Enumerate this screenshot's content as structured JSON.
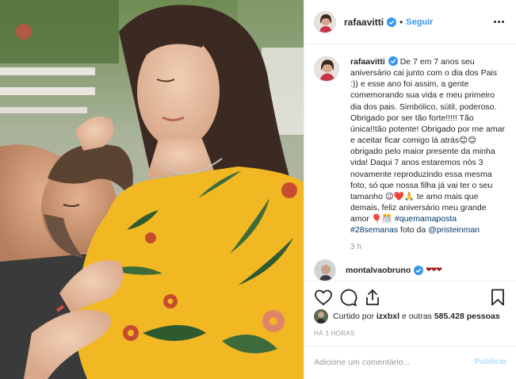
{
  "header": {
    "username": "rafaavitti",
    "separator": "•",
    "follow_label": "Seguir"
  },
  "caption": {
    "username": "rafaavitti",
    "text_parts": [
      " De 7 em 7 anos seu aniversário cai junto com o dia dos Pais :)) e esse ano foi assim, a gente comemorando sua vida e meu primeiro dia dos pais. Simbólico, sútil, poderoso. Obrigado por ser tão forte!!!!! Tão única!!tão potente! Obrigado por me amar e aceitar ficar comigo lá atrás😊😊 obrigado pelo maior presente da minha vida! Daqui 7 anos estaremos nós 3 novamente reproduzindo essa mesma foto, só que nossa filha já vai ter o seu tamanho 😉❤️🙏 te amo mais que demais, feliz aniversário meu grande amor 🎈🎊 ",
      "#quemamaposta",
      " ",
      "#28semanas",
      " foto da ",
      "@pristeinman"
    ],
    "time": "3 h"
  },
  "next_comment": {
    "username": "montalvaobruno",
    "hearts": "❤❤❤"
  },
  "likes": {
    "prefix": "Curtido por ",
    "user": "izxbxl",
    "middle": " e outras ",
    "count": "585.428 pessoas"
  },
  "time_ago": "HÁ 3 HORAS",
  "comment_box": {
    "placeholder": "Adicione um comentário...",
    "publish_label": "Publicar"
  },
  "colors": {
    "link": "#003569",
    "follow": "#3897f0",
    "publish_disabled": "#b2dffc",
    "dress_yellow": "#f2b824"
  },
  "icons": [
    "heart-icon",
    "comment-icon",
    "share-icon",
    "bookmark-icon",
    "verified-badge-icon",
    "more-options-icon"
  ]
}
